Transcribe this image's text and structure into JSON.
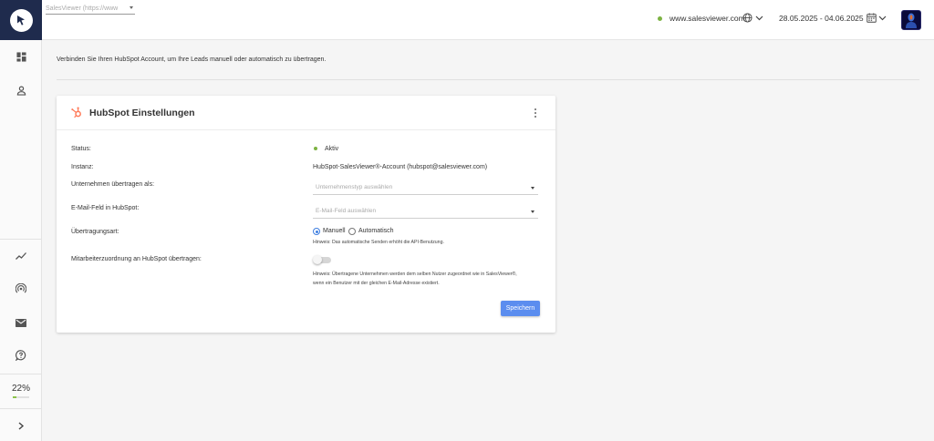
{
  "header": {
    "account_selector": "SalesViewer (https://www",
    "domain": "www.salesviewer.com",
    "date_range": "28.05.2025  -  04.06.2025"
  },
  "sidebar": {
    "items": [
      {
        "icon": "dashboard-icon"
      },
      {
        "icon": "user-icon"
      },
      {
        "icon": "trend-chart-icon"
      },
      {
        "icon": "broadcast-icon"
      },
      {
        "icon": "mail-icon"
      },
      {
        "icon": "help-bubble-icon"
      }
    ],
    "quota": {
      "label": "22%",
      "value": 0.22
    },
    "expand_icon": "chevron-right-icon"
  },
  "intro_text": "Verbinden Sie Ihren HubSpot Account, um Ihre Leads manuell oder automatisch zu übertragen.",
  "card": {
    "title": "HubSpot Einstellungen",
    "rows": {
      "status_label": "Status:",
      "status_value": "Aktiv",
      "instance_label": "Instanz:",
      "instance_value": "HubSpot-SalesViewer®-Account (hubspot@salesviewer.com)",
      "company_label": "Unternehmen übertragen als:",
      "company_placeholder": "Unternehmenstyp auswählen",
      "email_label": "E-Mail-Feld in HubSpot:",
      "email_placeholder": "E-Mail-Feld auswählen",
      "transfer_label": "Übertragungsart:",
      "option_manual": "Manuell",
      "option_auto": "Automatisch",
      "transfer_hint": "Hinweis: Das automatische Senden erhöht die API-Benutzung.",
      "mapping_label": "Mitarbeiterzuordnung an HubSpot übertragen:",
      "mapping_hint_1": "Hinweis: Übertragene Unternehmen werden dem selben Nutzer zugeordnet wie in SalesViewer®,",
      "mapping_hint_2": "wenn ein Benutzer mit der gleichen E-Mail-Adresse existiert."
    },
    "save_label": "Speichern",
    "selected_transfer": "Manuell",
    "mapping_enabled": false
  },
  "colors": {
    "accent": "#5b8def",
    "status_green": "#7cb342",
    "logo_bg": "#1f2b4d",
    "hubspot_orange": "#ff7a59"
  }
}
